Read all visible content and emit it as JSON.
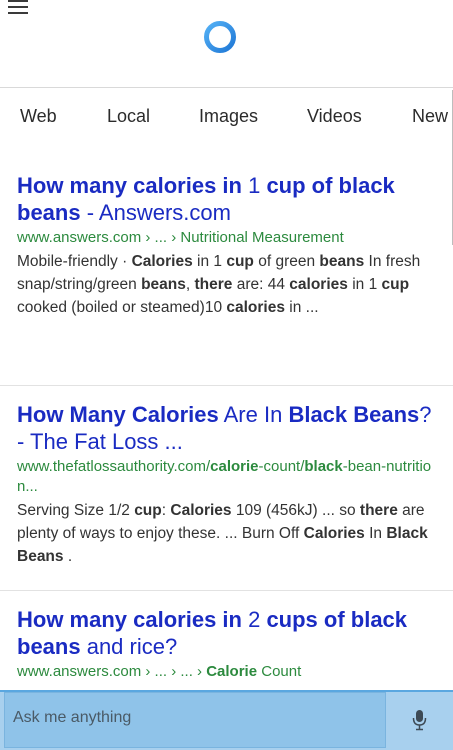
{
  "tabs": [
    "Web",
    "Local",
    "Images",
    "Videos",
    "New"
  ],
  "results": [
    {
      "title": [
        {
          "t": "How many calories in",
          "b": true
        },
        {
          "t": " 1 ",
          "b": false
        },
        {
          "t": "cup of black beans",
          "b": true
        },
        {
          "t": " - Answers.com",
          "b": false
        }
      ],
      "url": [
        {
          "t": "www.answers.com › ... › Nutritional Measurement",
          "b": false
        }
      ],
      "snippet": [
        {
          "t": "Mobile-friendly · ",
          "b": false
        },
        {
          "t": "Calories",
          "b": true
        },
        {
          "t": " in 1 ",
          "b": false
        },
        {
          "t": "cup",
          "b": true
        },
        {
          "t": " of green ",
          "b": false
        },
        {
          "t": "beans",
          "b": true
        },
        {
          "t": " In fresh snap/string/green ",
          "b": false
        },
        {
          "t": "beans",
          "b": true
        },
        {
          "t": ", ",
          "b": false
        },
        {
          "t": "there",
          "b": true
        },
        {
          "t": " are: 44 ",
          "b": false
        },
        {
          "t": "calories",
          "b": true
        },
        {
          "t": " in 1 ",
          "b": false
        },
        {
          "t": "cup",
          "b": true
        },
        {
          "t": " cooked (boiled or steamed)10 ",
          "b": false
        },
        {
          "t": "calories",
          "b": true
        },
        {
          "t": " in ...",
          "b": false
        }
      ]
    },
    {
      "title": [
        {
          "t": "How Many Calories",
          "b": true
        },
        {
          "t": " Are In ",
          "b": false
        },
        {
          "t": "Black Beans",
          "b": true
        },
        {
          "t": "? - The Fat Loss ...",
          "b": false
        }
      ],
      "url": [
        {
          "t": "www.thefatlossauthority.com/",
          "b": false
        },
        {
          "t": "calorie",
          "b": true
        },
        {
          "t": "-count/",
          "b": false
        },
        {
          "t": "black",
          "b": true
        },
        {
          "t": "-bean-nutrition...",
          "b": false
        }
      ],
      "snippet": [
        {
          "t": "Serving Size 1/2 ",
          "b": false
        },
        {
          "t": "cup",
          "b": true
        },
        {
          "t": ": ",
          "b": false
        },
        {
          "t": "Calories",
          "b": true
        },
        {
          "t": " 109 (456kJ) ... so ",
          "b": false
        },
        {
          "t": "there",
          "b": true
        },
        {
          "t": " are plenty of ways to enjoy these. ... Burn Off ",
          "b": false
        },
        {
          "t": "Calories",
          "b": true
        },
        {
          "t": " In ",
          "b": false
        },
        {
          "t": "Black Beans",
          "b": true
        },
        {
          "t": " .",
          "b": false
        }
      ]
    },
    {
      "title": [
        {
          "t": "How many calories in",
          "b": true
        },
        {
          "t": " 2 ",
          "b": false
        },
        {
          "t": "cups of black beans",
          "b": true
        },
        {
          "t": " and rice?",
          "b": false
        }
      ],
      "url": [
        {
          "t": "www.answers.com › ... › ... › ",
          "b": false
        },
        {
          "t": "Calorie",
          "b": true
        },
        {
          "t": " Count",
          "b": false
        }
      ],
      "snippet": []
    }
  ],
  "search": {
    "placeholder": "Ask me anything"
  },
  "icons": {
    "menu": "hamburger-menu-icon",
    "assistant": "cortana-circle-icon",
    "mic": "microphone-icon"
  },
  "colors": {
    "title_link": "#1a2bc2",
    "url_green": "#2c8a3e",
    "cortana_blue": "#2f8fe6",
    "ask_bar": "#a8d0ee"
  }
}
